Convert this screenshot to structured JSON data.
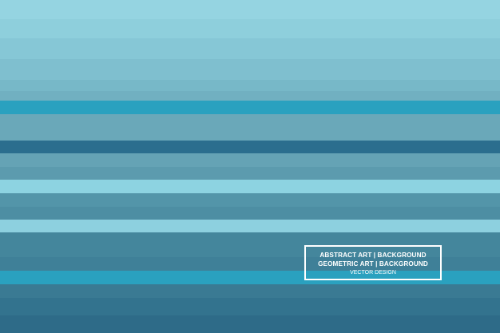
{
  "caption": {
    "line1": "ABSTRACT ART | BACKGROUND",
    "line2": "GEOMETRIC ART | BACKGROUND",
    "line3": "VECTOR DESIGN"
  },
  "colors": {
    "text": "#ffffff",
    "stripes": [
      "#95d4e1",
      "#8ecfdc",
      "#86c7d6",
      "#7fbfcf",
      "#77b8c8",
      "#71b0c1",
      "#2aa1bf",
      "#6aa8b9",
      "#2b6e8e",
      "#65a3b5",
      "#5c9bae",
      "#8dd3e1",
      "#5395a9",
      "#4d8ea3",
      "#8dd0df",
      "#44869c",
      "#3f8098",
      "#2aa1bf",
      "#3a7a93",
      "#33738e",
      "#2e6b88"
    ]
  }
}
